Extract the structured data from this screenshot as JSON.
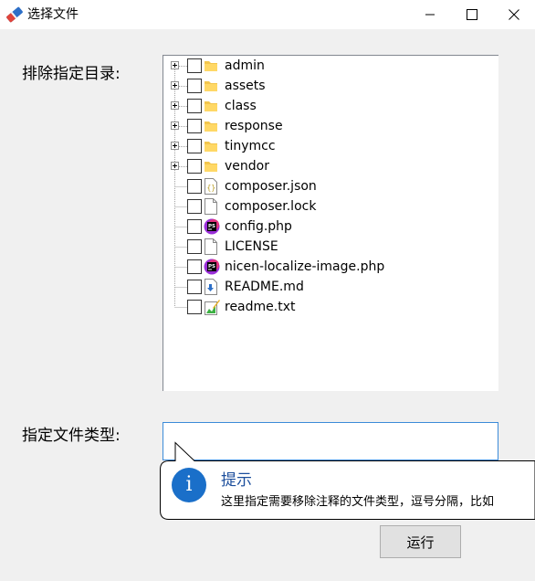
{
  "window": {
    "title": "选择文件",
    "icons": {
      "app": "eraser-icon",
      "minimize": "minimize-icon",
      "maximize": "maximize-icon",
      "close": "close-icon"
    }
  },
  "form": {
    "exclude_label": "排除指定目录:",
    "types_label": "指定文件类型:",
    "types_value": "",
    "run_label": "运行"
  },
  "tree": {
    "items": [
      {
        "label": "admin",
        "kind": "folder",
        "expandable": true,
        "checked": false,
        "icon": "folder-icon"
      },
      {
        "label": "assets",
        "kind": "folder",
        "expandable": true,
        "checked": false,
        "icon": "folder-icon"
      },
      {
        "label": "class",
        "kind": "folder",
        "expandable": true,
        "checked": false,
        "icon": "folder-icon"
      },
      {
        "label": "response",
        "kind": "folder",
        "expandable": true,
        "checked": false,
        "icon": "folder-icon"
      },
      {
        "label": "tinymcc",
        "kind": "folder",
        "expandable": true,
        "checked": false,
        "icon": "folder-icon"
      },
      {
        "label": "vendor",
        "kind": "folder",
        "expandable": true,
        "checked": false,
        "icon": "folder-icon"
      },
      {
        "label": "composer.json",
        "kind": "json",
        "expandable": false,
        "checked": false,
        "icon": "json-file-icon"
      },
      {
        "label": "composer.lock",
        "kind": "file",
        "expandable": false,
        "checked": false,
        "icon": "file-icon"
      },
      {
        "label": "config.php",
        "kind": "php",
        "expandable": false,
        "checked": false,
        "icon": "phpstorm-file-icon"
      },
      {
        "label": "LICENSE",
        "kind": "file",
        "expandable": false,
        "checked": false,
        "icon": "file-icon"
      },
      {
        "label": "nicen-localize-image.php",
        "kind": "php",
        "expandable": false,
        "checked": false,
        "icon": "phpstorm-file-icon"
      },
      {
        "label": "README.md",
        "kind": "md",
        "expandable": false,
        "checked": false,
        "icon": "markdown-file-icon"
      },
      {
        "label": "readme.txt",
        "kind": "txt",
        "expandable": false,
        "checked": false,
        "icon": "text-file-icon"
      }
    ]
  },
  "tooltip": {
    "icon": "info-icon",
    "icon_glyph": "i",
    "title": "提示",
    "message": "这里指定需要移除注释的文件类型，逗号分隔，比如"
  }
}
